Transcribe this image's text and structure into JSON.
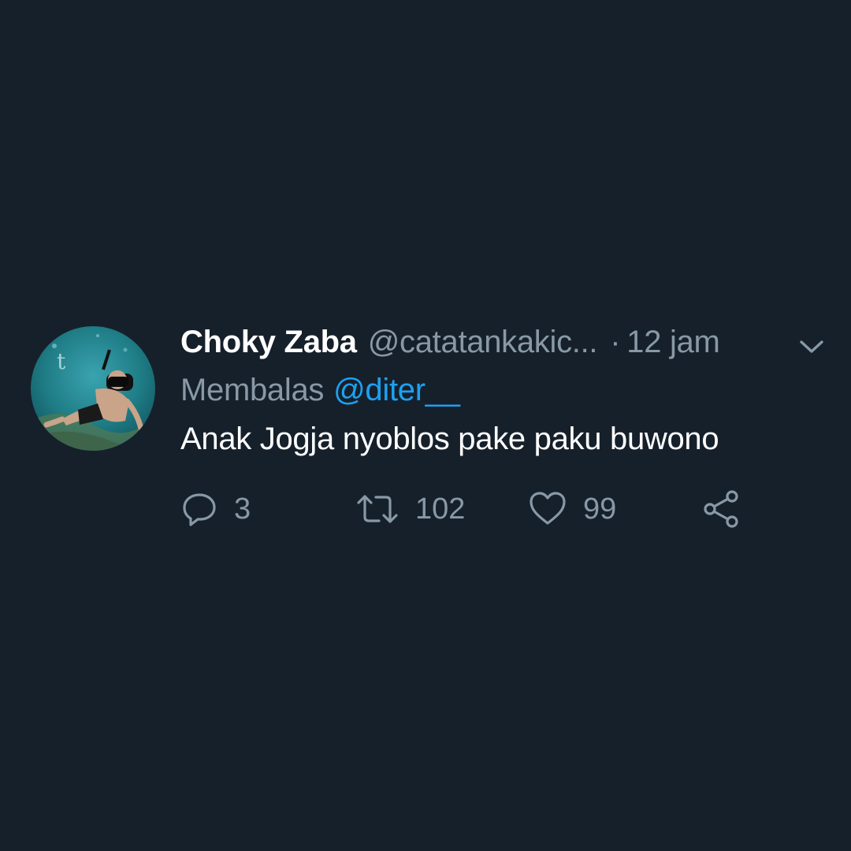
{
  "tweet": {
    "display_name": "Choky Zaba",
    "handle": "@catatankakic...",
    "separator": "·",
    "time": "12 jam",
    "reply_label": "Membalas",
    "reply_to": "@diter__",
    "text": "Anak Jogja nyoblos pake paku buwono",
    "avatar_letter": "t"
  },
  "actions": {
    "reply": {
      "icon": "reply-icon",
      "count": "3"
    },
    "retweet": {
      "icon": "retweet-icon",
      "count": "102"
    },
    "like": {
      "icon": "heart-icon",
      "count": "99"
    },
    "share": {
      "icon": "share-icon"
    }
  },
  "colors": {
    "background": "#16202b",
    "primary_text": "#ffffff",
    "secondary_text": "#8899a6",
    "link": "#1da1f2"
  }
}
